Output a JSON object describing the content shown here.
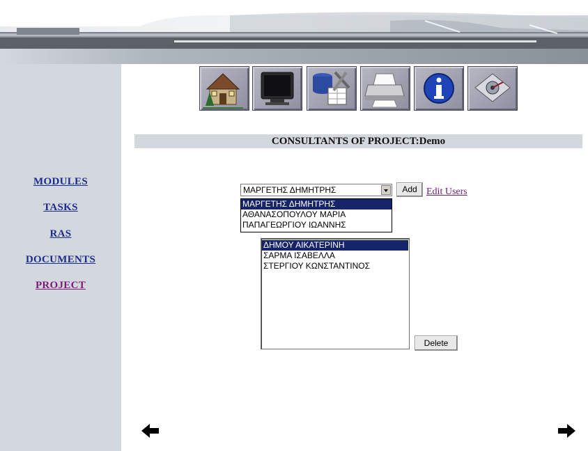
{
  "toolbar": {
    "icons": [
      "house-icon",
      "monitor-icon",
      "database-tools-icon",
      "printer-icon",
      "info-icon",
      "disk-icon"
    ]
  },
  "sidebar": {
    "items": [
      {
        "label": "MODULES"
      },
      {
        "label": "TASKS"
      },
      {
        "label": "RAS"
      },
      {
        "label": "DOCUMENTS"
      },
      {
        "label": "PROJECT"
      }
    ]
  },
  "main": {
    "title": "CONSULTANTS OF PROJECT:Demo",
    "select": {
      "value": "ΜΑΡΓΕΤΗΣ ΔΗΜΗΤΡΗΣ",
      "options": [
        "ΜΑΡΓΕΤΗΣ ΔΗΜΗΤΡΗΣ",
        "ΑΘΑΝΑΣΟΠΟΥΛΟΥ ΜΑΡΙΑ",
        "ΠΑΠΑΓΕΩΡΓΙΟΥ ΙΩΑΝΝΗΣ"
      ]
    },
    "add_label": "Add",
    "edit_users_label": "Edit Users",
    "consultants": [
      "ΔΗΜΟΥ ΑΙΚΑΤΕΡΙΝΗ",
      "ΣΑΡΜΑ ΙΣΑΒΕΛΛΑ",
      "ΣΤΕΡΓΙΟΥ ΚΩΝΣΤΑΝΤΙΝΟΣ"
    ],
    "delete_label": "Delete"
  },
  "colors": {
    "sidebar_bg": "#d3d8df",
    "link": "#1c2c8c",
    "visited_link": "#7d1a78",
    "selection": "#16246a"
  }
}
